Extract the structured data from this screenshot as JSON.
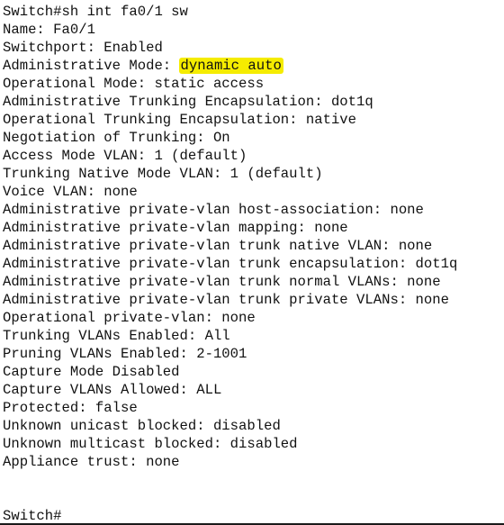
{
  "terminal": {
    "command_line": "Switch#sh int fa0/1 sw",
    "output": {
      "name": "Name: Fa0/1",
      "switchport": "Switchport: Enabled",
      "admin_mode_label": "Administrative Mode: ",
      "admin_mode_value": "dynamic auto",
      "admin_mode_highlight_color": "#f5ec00",
      "oper_mode": "Operational Mode: static access",
      "admin_trunk_encap": "Administrative Trunking Encapsulation: dot1q",
      "oper_trunk_encap": "Operational Trunking Encapsulation: native",
      "negotiation": "Negotiation of Trunking: On",
      "access_vlan": "Access Mode VLAN: 1 (default)",
      "trunk_native_vlan": "Trunking Native Mode VLAN: 1 (default)",
      "voice_vlan": "Voice VLAN: none",
      "pvlan_host_assoc": "Administrative private-vlan host-association: none",
      "pvlan_mapping": "Administrative private-vlan mapping: none",
      "pvlan_trunk_native": "Administrative private-vlan trunk native VLAN: none",
      "pvlan_trunk_encap": "Administrative private-vlan trunk encapsulation: dot1q",
      "pvlan_trunk_normal": "Administrative private-vlan trunk normal VLANs: none",
      "pvlan_trunk_private": "Administrative private-vlan trunk private VLANs: none",
      "oper_pvlan": "Operational private-vlan: none",
      "trunk_vlans": "Trunking VLANs Enabled: All",
      "pruning_vlans": "Pruning VLANs Enabled: 2-1001",
      "capture_mode": "Capture Mode Disabled",
      "capture_vlans": "Capture VLANs Allowed: ALL",
      "protected": "Protected: false",
      "unknown_unicast": "Unknown unicast blocked: disabled",
      "unknown_multicast": "Unknown multicast blocked: disabled",
      "appliance_trust": "Appliance trust: none"
    },
    "prompt": "Switch#"
  }
}
